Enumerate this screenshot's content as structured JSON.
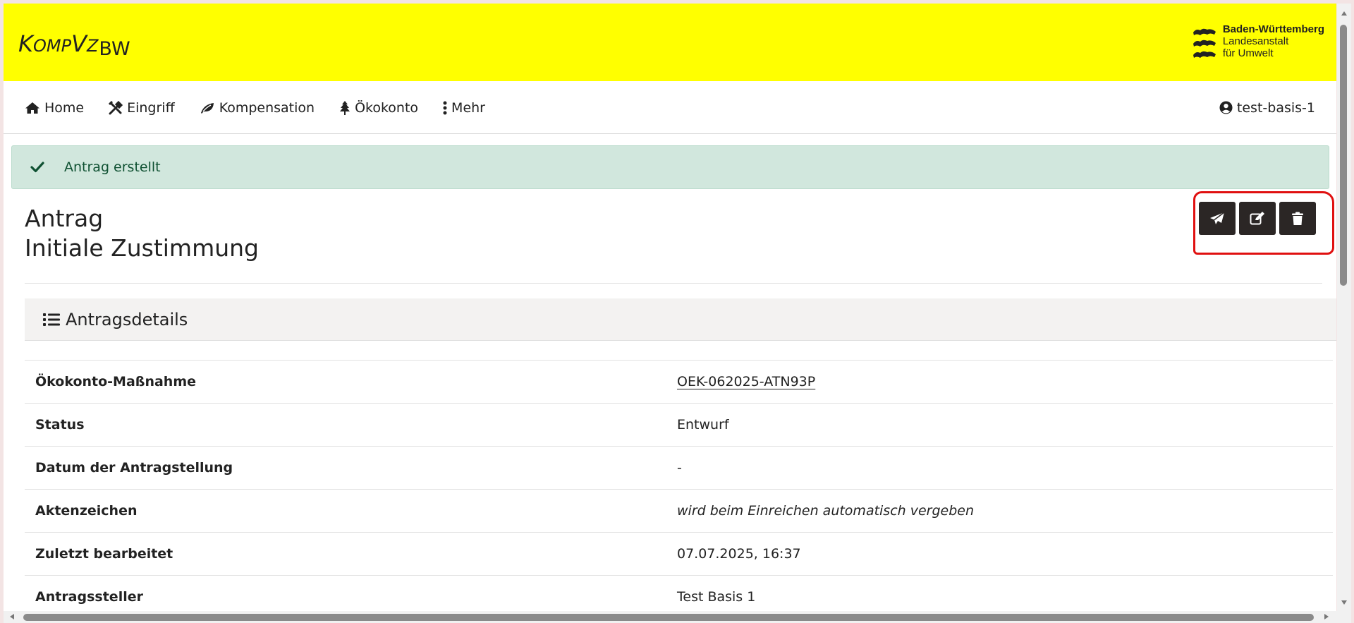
{
  "header": {
    "logo": {
      "k": "K",
      "omp": "OMP",
      "v": "V",
      "z": "Z",
      "bw": "BW"
    },
    "brand": {
      "line1": "Baden-Württemberg",
      "line2": "Landesanstalt",
      "line3": "für Umwelt"
    }
  },
  "nav": {
    "items": [
      {
        "label": "Home",
        "icon": "home-icon"
      },
      {
        "label": "Eingriff",
        "icon": "tools-icon"
      },
      {
        "label": "Kompensation",
        "icon": "leaf-icon"
      },
      {
        "label": "Ökokonto",
        "icon": "tree-icon"
      },
      {
        "label": "Mehr",
        "icon": "ellipsis-vertical-icon"
      }
    ],
    "user": "test-basis-1"
  },
  "alert": {
    "message": "Antrag erstellt"
  },
  "title": {
    "line1": "Antrag",
    "line2": "Initiale Zustimmung"
  },
  "actions": [
    {
      "name": "submit-button",
      "icon": "paper-plane-icon"
    },
    {
      "name": "edit-button",
      "icon": "edit-icon"
    },
    {
      "name": "delete-button",
      "icon": "trash-icon"
    }
  ],
  "card": {
    "title": "Antragsdetails"
  },
  "details": {
    "rows": [
      {
        "label": "Ökokonto-Maßnahme",
        "value": "OEK-062025-ATN93P"
      },
      {
        "label": "Status",
        "value": "Entwurf"
      },
      {
        "label": "Datum der Antragstellung",
        "value": "-"
      },
      {
        "label": "Aktenzeichen",
        "value": "wird beim Einreichen automatisch vergeben"
      },
      {
        "label": "Zuletzt bearbeitet",
        "value": "07.07.2025, 16:37"
      },
      {
        "label": "Antragssteller",
        "value": "Test Basis 1"
      }
    ]
  },
  "colors": {
    "header_bg": "#ffff00",
    "alert_bg": "#d1e7dd",
    "button_bg": "#2b2625",
    "highlight": "#e01010"
  }
}
